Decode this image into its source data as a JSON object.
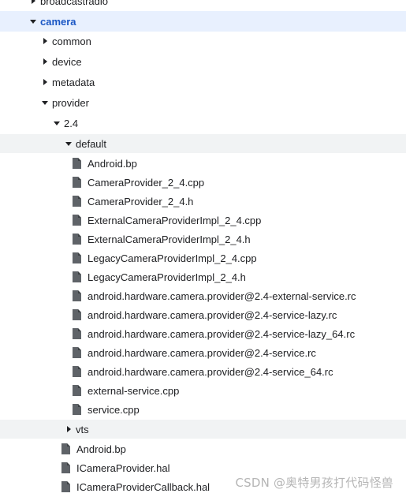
{
  "tree": [
    {
      "label": "broadcastradio",
      "type": "folder",
      "expanded": false,
      "depth": 0,
      "state": "normal",
      "name": "tree-folder-broadcastradio"
    },
    {
      "label": "camera",
      "type": "folder",
      "expanded": true,
      "depth": 0,
      "state": "selected",
      "name": "tree-folder-camera"
    },
    {
      "label": "common",
      "type": "folder",
      "expanded": false,
      "depth": 1,
      "state": "normal",
      "name": "tree-folder-common"
    },
    {
      "label": "device",
      "type": "folder",
      "expanded": false,
      "depth": 1,
      "state": "normal",
      "name": "tree-folder-device"
    },
    {
      "label": "metadata",
      "type": "folder",
      "expanded": false,
      "depth": 1,
      "state": "normal",
      "name": "tree-folder-metadata"
    },
    {
      "label": "provider",
      "type": "folder",
      "expanded": true,
      "depth": 1,
      "state": "normal",
      "name": "tree-folder-provider"
    },
    {
      "label": "2.4",
      "type": "folder",
      "expanded": true,
      "depth": 2,
      "state": "normal",
      "name": "tree-folder-2-4"
    },
    {
      "label": "default",
      "type": "folder",
      "expanded": true,
      "depth": 3,
      "state": "hover",
      "name": "tree-folder-default"
    },
    {
      "label": "Android.bp",
      "type": "file",
      "depth": 4,
      "state": "normal",
      "name": "tree-file-android-bp"
    },
    {
      "label": "CameraProvider_2_4.cpp",
      "type": "file",
      "depth": 4,
      "state": "normal",
      "name": "tree-file-cameraprovider-cpp"
    },
    {
      "label": "CameraProvider_2_4.h",
      "type": "file",
      "depth": 4,
      "state": "normal",
      "name": "tree-file-cameraprovider-h"
    },
    {
      "label": "ExternalCameraProviderImpl_2_4.cpp",
      "type": "file",
      "depth": 4,
      "state": "normal",
      "name": "tree-file-externalcameraproviderimpl-cpp"
    },
    {
      "label": "ExternalCameraProviderImpl_2_4.h",
      "type": "file",
      "depth": 4,
      "state": "normal",
      "name": "tree-file-externalcameraproviderimpl-h"
    },
    {
      "label": "LegacyCameraProviderImpl_2_4.cpp",
      "type": "file",
      "depth": 4,
      "state": "normal",
      "name": "tree-file-legacycameraproviderimpl-cpp"
    },
    {
      "label": "LegacyCameraProviderImpl_2_4.h",
      "type": "file",
      "depth": 4,
      "state": "normal",
      "name": "tree-file-legacycameraproviderimpl-h"
    },
    {
      "label": "android.hardware.camera.provider@2.4-external-service.rc",
      "type": "file",
      "depth": 4,
      "state": "normal",
      "name": "tree-file-external-service-rc"
    },
    {
      "label": "android.hardware.camera.provider@2.4-service-lazy.rc",
      "type": "file",
      "depth": 4,
      "state": "normal",
      "name": "tree-file-service-lazy-rc"
    },
    {
      "label": "android.hardware.camera.provider@2.4-service-lazy_64.rc",
      "type": "file",
      "depth": 4,
      "state": "normal",
      "name": "tree-file-service-lazy-64-rc"
    },
    {
      "label": "android.hardware.camera.provider@2.4-service.rc",
      "type": "file",
      "depth": 4,
      "state": "normal",
      "name": "tree-file-service-rc"
    },
    {
      "label": "android.hardware.camera.provider@2.4-service_64.rc",
      "type": "file",
      "depth": 4,
      "state": "normal",
      "name": "tree-file-service-64-rc"
    },
    {
      "label": "external-service.cpp",
      "type": "file",
      "depth": 4,
      "state": "normal",
      "name": "tree-file-external-service-cpp"
    },
    {
      "label": "service.cpp",
      "type": "file",
      "depth": 4,
      "state": "normal",
      "name": "tree-file-service-cpp"
    },
    {
      "label": "vts",
      "type": "folder",
      "expanded": false,
      "depth": 3,
      "state": "hover",
      "name": "tree-folder-vts"
    },
    {
      "label": "Android.bp",
      "type": "file",
      "depth": 3,
      "state": "normal",
      "name": "tree-file-android-bp-2-4"
    },
    {
      "label": "ICameraProvider.hal",
      "type": "file",
      "depth": 3,
      "state": "normal",
      "name": "tree-file-icameraprovider-hal"
    },
    {
      "label": "ICameraProviderCallback.hal",
      "type": "file",
      "depth": 3,
      "state": "normal",
      "name": "tree-file-icameraprovidercallback-hal"
    }
  ],
  "watermark": "CSDN @奥特男孩打代码怪兽",
  "colors": {
    "selected_bg": "#e8f0fe",
    "selected_text": "#1a56c4",
    "hover_bg": "#f1f3f4",
    "text": "#202124",
    "icon": "#5f6368"
  },
  "icons": {
    "folder_open": "triangle-down-icon",
    "folder_closed": "triangle-right-icon",
    "file": "file-icon"
  }
}
